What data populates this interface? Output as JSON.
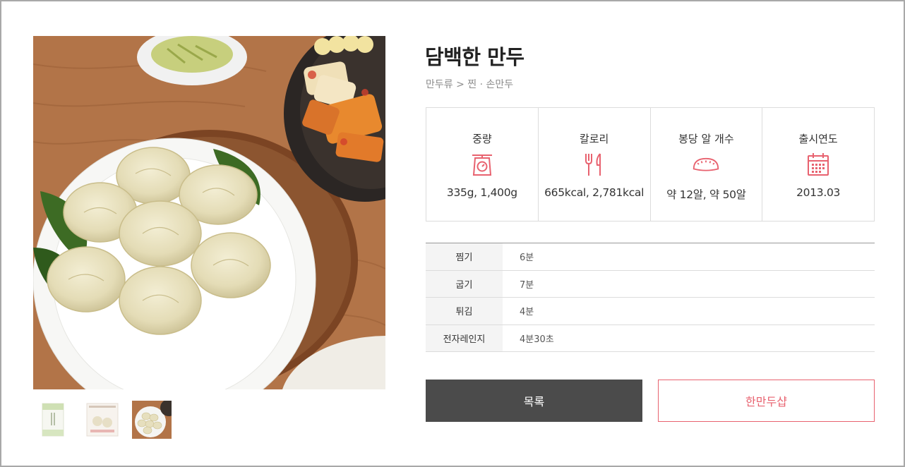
{
  "product": {
    "title": "담백한 만두",
    "breadcrumb": "만두류 > 찐 · 손만두"
  },
  "specs": [
    {
      "label": "중량",
      "icon": "scale-icon",
      "value": "335g, 1,400g"
    },
    {
      "label": "칼로리",
      "icon": "fork-knife-icon",
      "value": "665kcal, 2,781kcal"
    },
    {
      "label": "봉당 알 개수",
      "icon": "dumpling-icon",
      "value": "약 12알, 약 50알"
    },
    {
      "label": "출시연도",
      "icon": "calendar-icon",
      "value": "2013.03"
    }
  ],
  "cooking": [
    {
      "method": "찜기",
      "time": "6분"
    },
    {
      "method": "굽기",
      "time": "7분"
    },
    {
      "method": "튀김",
      "time": "4분"
    },
    {
      "method": "전자레인지",
      "time": "4분30초"
    }
  ],
  "buttons": {
    "list": "목록",
    "shop": "한만두샵"
  },
  "colors": {
    "accent": "#e8626f",
    "dark_button": "#4b4b4b"
  },
  "thumbnails": [
    {
      "icon": "package-front-thumbnail"
    },
    {
      "icon": "package-back-thumbnail"
    },
    {
      "icon": "dumpling-plate-thumbnail"
    }
  ],
  "gallery": {
    "selected_thumbnail": 3
  }
}
